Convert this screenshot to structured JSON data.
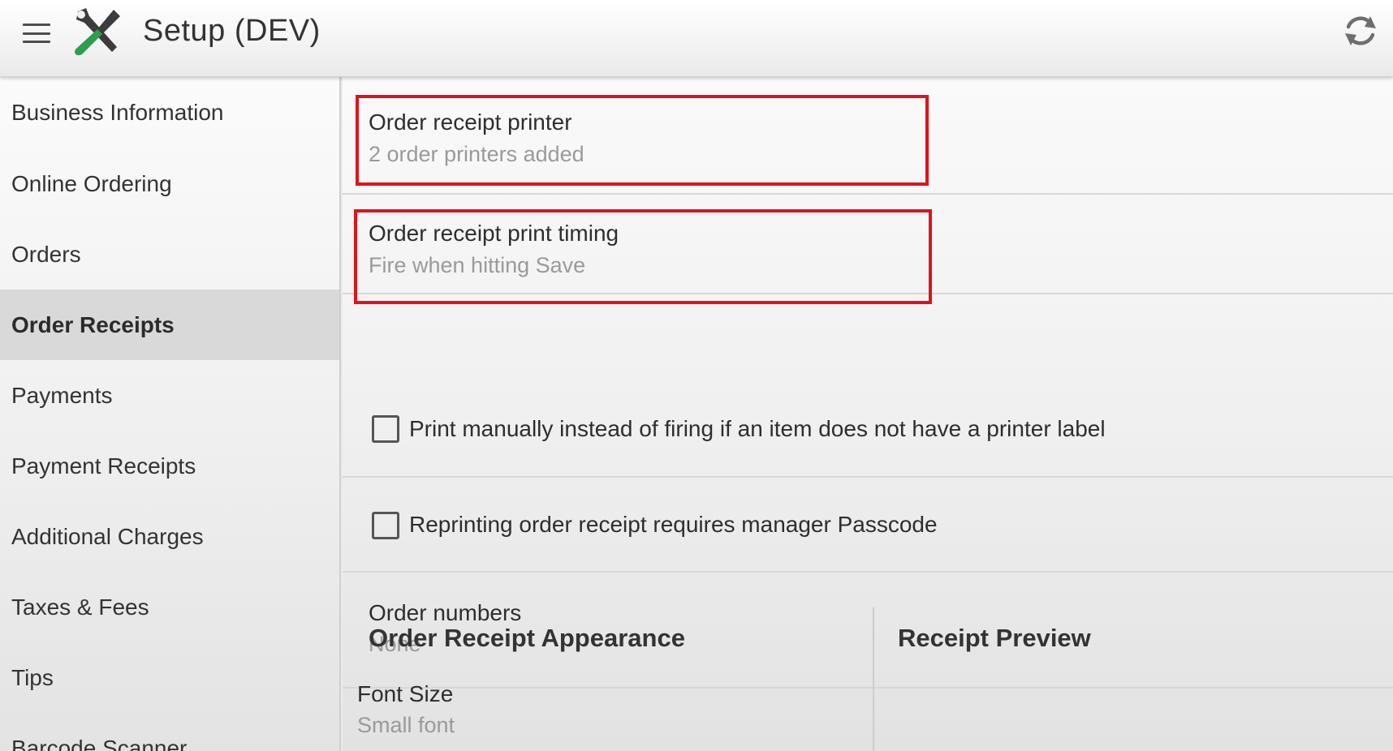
{
  "appbar": {
    "title": "Setup (DEV)",
    "menu_icon": "hamburger-menu-icon",
    "app_icon": "tools-icon",
    "sync_icon": "sync-icon"
  },
  "sidebar": {
    "items": [
      {
        "label": "Business Information",
        "active": false
      },
      {
        "label": "Online Ordering",
        "active": false
      },
      {
        "label": "Orders",
        "active": false
      },
      {
        "label": "Order Receipts",
        "active": true
      },
      {
        "label": "Payments",
        "active": false
      },
      {
        "label": "Payment Receipts",
        "active": false
      },
      {
        "label": "Additional Charges",
        "active": false
      },
      {
        "label": "Taxes & Fees",
        "active": false
      },
      {
        "label": "Tips",
        "active": false
      },
      {
        "label": "Barcode Scanner",
        "active": false
      }
    ]
  },
  "main": {
    "printer": {
      "title": "Order receipt printer",
      "summary": "2 order printers added"
    },
    "timing": {
      "title": "Order receipt print timing",
      "summary": "Fire when hitting Save"
    },
    "manual_print": {
      "label": "Print manually instead of firing if an item does not have a printer label",
      "checked": false
    },
    "reprint_passcode": {
      "label": "Reprinting order receipt requires manager Passcode",
      "checked": false
    },
    "order_numbers": {
      "title": "Order numbers",
      "summary": "None"
    },
    "appearance": {
      "heading": "Order Receipt Appearance",
      "font_size": {
        "title": "Font Size",
        "summary": "Small font"
      }
    },
    "preview": {
      "heading": "Receipt Preview"
    }
  },
  "colors": {
    "highlight": "#e0121c",
    "active_item_bg": "#d9d9d9",
    "tools_green": "#2e9e4f"
  }
}
